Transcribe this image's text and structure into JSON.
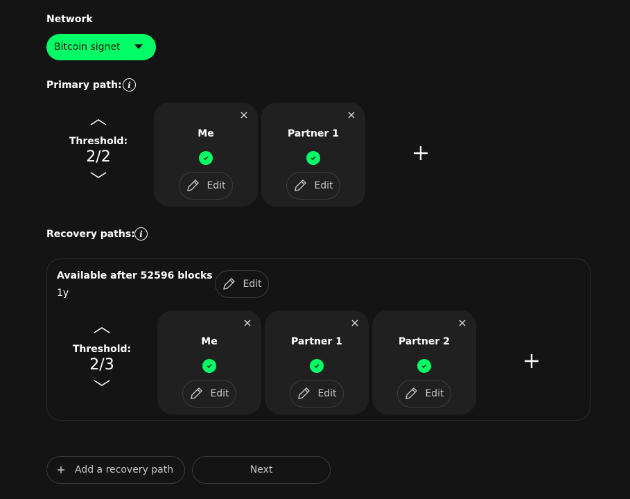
{
  "network": {
    "label": "Network",
    "selected": "Bitcoin signet",
    "accent_color": "#00ff66"
  },
  "primary_path": {
    "label": "Primary path:",
    "threshold_label": "Threshold:",
    "threshold_value": "2/2",
    "keys": [
      {
        "name": "Me",
        "status": "check-icon",
        "edit_label": "Edit"
      },
      {
        "name": "Partner 1",
        "status": "check-icon",
        "edit_label": "Edit"
      }
    ]
  },
  "recovery_paths": {
    "label": "Recovery paths:",
    "paths": [
      {
        "title": "Available after 52596 blocks",
        "duration": "1y",
        "edit_label": "Edit",
        "threshold_label": "Threshold:",
        "threshold_value": "2/3",
        "keys": [
          {
            "name": "Me",
            "status": "check-icon",
            "edit_label": "Edit"
          },
          {
            "name": "Partner 1",
            "status": "check-icon",
            "edit_label": "Edit"
          },
          {
            "name": "Partner 2",
            "status": "check-icon",
            "edit_label": "Edit"
          }
        ]
      }
    ]
  },
  "footer": {
    "add_recovery_label": "Add a recovery path",
    "next_label": "Next"
  }
}
